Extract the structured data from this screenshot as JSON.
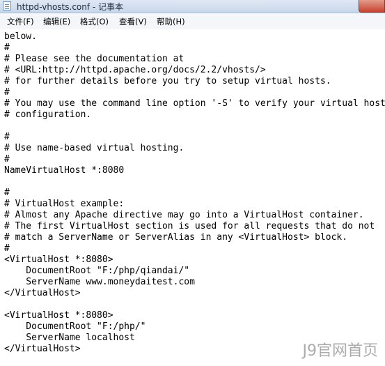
{
  "window": {
    "title": "httpd-vhosts.conf - 记事本",
    "app_icon": "notepad-icon"
  },
  "menu": [
    {
      "label": "文件(F)"
    },
    {
      "label": "编辑(E)"
    },
    {
      "label": "格式(O)"
    },
    {
      "label": "查看(V)"
    },
    {
      "label": "帮助(H)"
    }
  ],
  "editor": {
    "lines": [
      "below.",
      "#",
      "# Please see the documentation at",
      "# <URL:http://httpd.apache.org/docs/2.2/vhosts/>",
      "# for further details before you try to setup virtual hosts.",
      "#",
      "# You may use the command line option '-S' to verify your virtual host",
      "# configuration.",
      "",
      "#",
      "# Use name-based virtual hosting.",
      "#",
      "NameVirtualHost *:8080",
      "",
      "#",
      "# VirtualHost example:",
      "# Almost any Apache directive may go into a VirtualHost container.",
      "# The first VirtualHost section is used for all requests that do not",
      "# match a ServerName or ServerAlias in any <VirtualHost> block.",
      "#",
      "<VirtualHost *:8080>",
      "    DocumentRoot \"F:/php/qiandai/\"",
      "    ServerName www.moneydaitest.com",
      "</VirtualHost>",
      "",
      "<VirtualHost *:8080>",
      "    DocumentRoot \"F:/php/\"",
      "    ServerName localhost",
      "</VirtualHost>"
    ]
  },
  "watermark": {
    "text": "J9官网首页"
  }
}
